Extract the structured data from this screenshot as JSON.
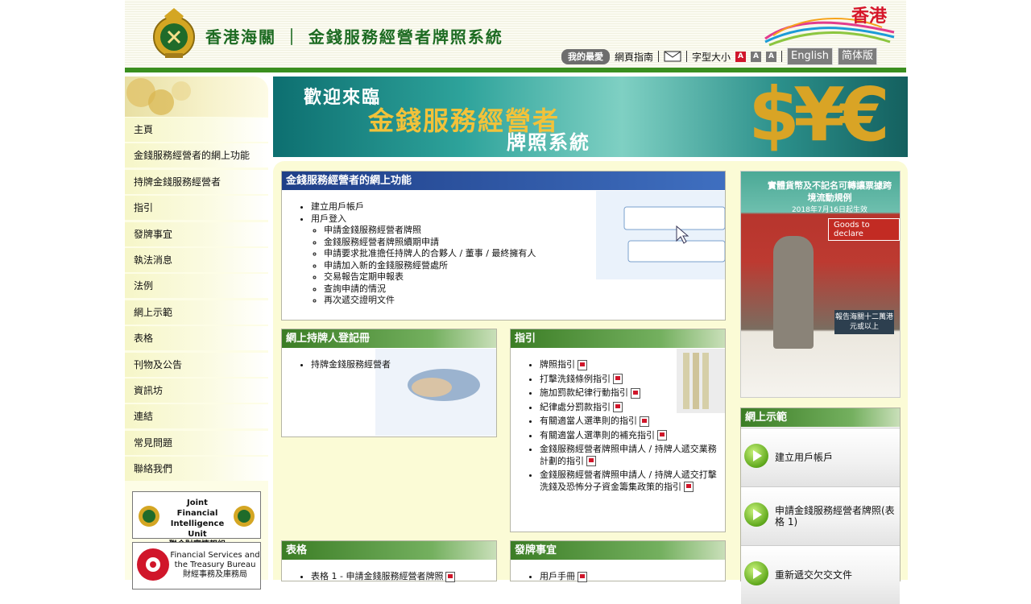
{
  "header": {
    "site_title": "香港海關 ｜ 金錢服務經營者牌照系統",
    "hk_brand": "香港",
    "favourites": "我的最愛",
    "web_guide": "網頁指南",
    "font_size_label": "字型大小",
    "font_sizes": [
      "A",
      "A",
      "A"
    ],
    "english": "English",
    "simplified": "简体版"
  },
  "nav": {
    "items": [
      "主頁",
      "金錢服務經營者的網上功能",
      "持牌金錢服務經營者",
      "指引",
      "發牌事宜",
      "執法消息",
      "法例",
      "網上示範",
      "表格",
      "刊物及公告",
      "資訊坊",
      "連結",
      "常見問題",
      "聯絡我們"
    ],
    "jfiu": {
      "line1": "Joint Financial",
      "line2": "Intelligence Unit",
      "line3": "聯合財富情報組"
    },
    "fstb": {
      "line1": "Financial Services and",
      "line2": "the Treasury Bureau",
      "line3": "財經事務及庫務局"
    }
  },
  "banner": {
    "welcome": "歡迎來臨",
    "title1": "金錢服務經營者",
    "title2": "牌照系統",
    "symbols": "$¥€£"
  },
  "online": {
    "title": "金錢服務經營者的網上功能",
    "item1": "建立用戶帳戶",
    "item2": "用戶登入",
    "subitems": [
      "申請金錢服務經營者牌照",
      "金錢服務經營者牌照續期申請",
      "申請要求批准擔任持牌人的合夥人 / 董事 / 最終擁有人",
      "申請加入新的金錢服務經營處所",
      "交易報告定期申報表",
      "查詢申請的情況",
      "再次遞交證明文件"
    ]
  },
  "register": {
    "title": "網上持牌人登記冊",
    "item": "持牌金錢服務經營者"
  },
  "guide": {
    "title": "指引",
    "items": [
      "牌照指引",
      "打擊洗錢條例指引",
      "施加罰款紀律行動指引",
      "紀律處分罰款指引",
      "有關適當人選準則的指引",
      "有關適當人選準則的補充指引",
      "金錢服務經營者牌照申請人 / 持牌人遞交業務計劃的指引",
      "金錢服務經營者牌照申請人 / 持牌人遞交打擊洗錢及恐怖分子資金籌集政策的指引"
    ]
  },
  "forms": {
    "title": "表格",
    "item": "表格 1 - 申請金錢服務經營者牌照"
  },
  "licensing": {
    "title": "發牌事宜",
    "item": "用戶手冊"
  },
  "promo": {
    "title": "實體貨幣及不記名可轉讓票據跨境流動規例",
    "date": "2018年7月16日起生效",
    "sign": "Goods to declare",
    "box": "報告海關十二萬港元或以上"
  },
  "demo": {
    "title": "網上示範",
    "items": [
      "建立用戶帳戶",
      "申請金錢服務經營者牌照(表格 1)",
      "重新遞交欠交文件"
    ]
  },
  "colors": {
    "header_bar": "#3a8f1f",
    "blue_head": "#1f3f88",
    "green_head": "#3b7d25",
    "nav_bg": "#fdfde6"
  }
}
